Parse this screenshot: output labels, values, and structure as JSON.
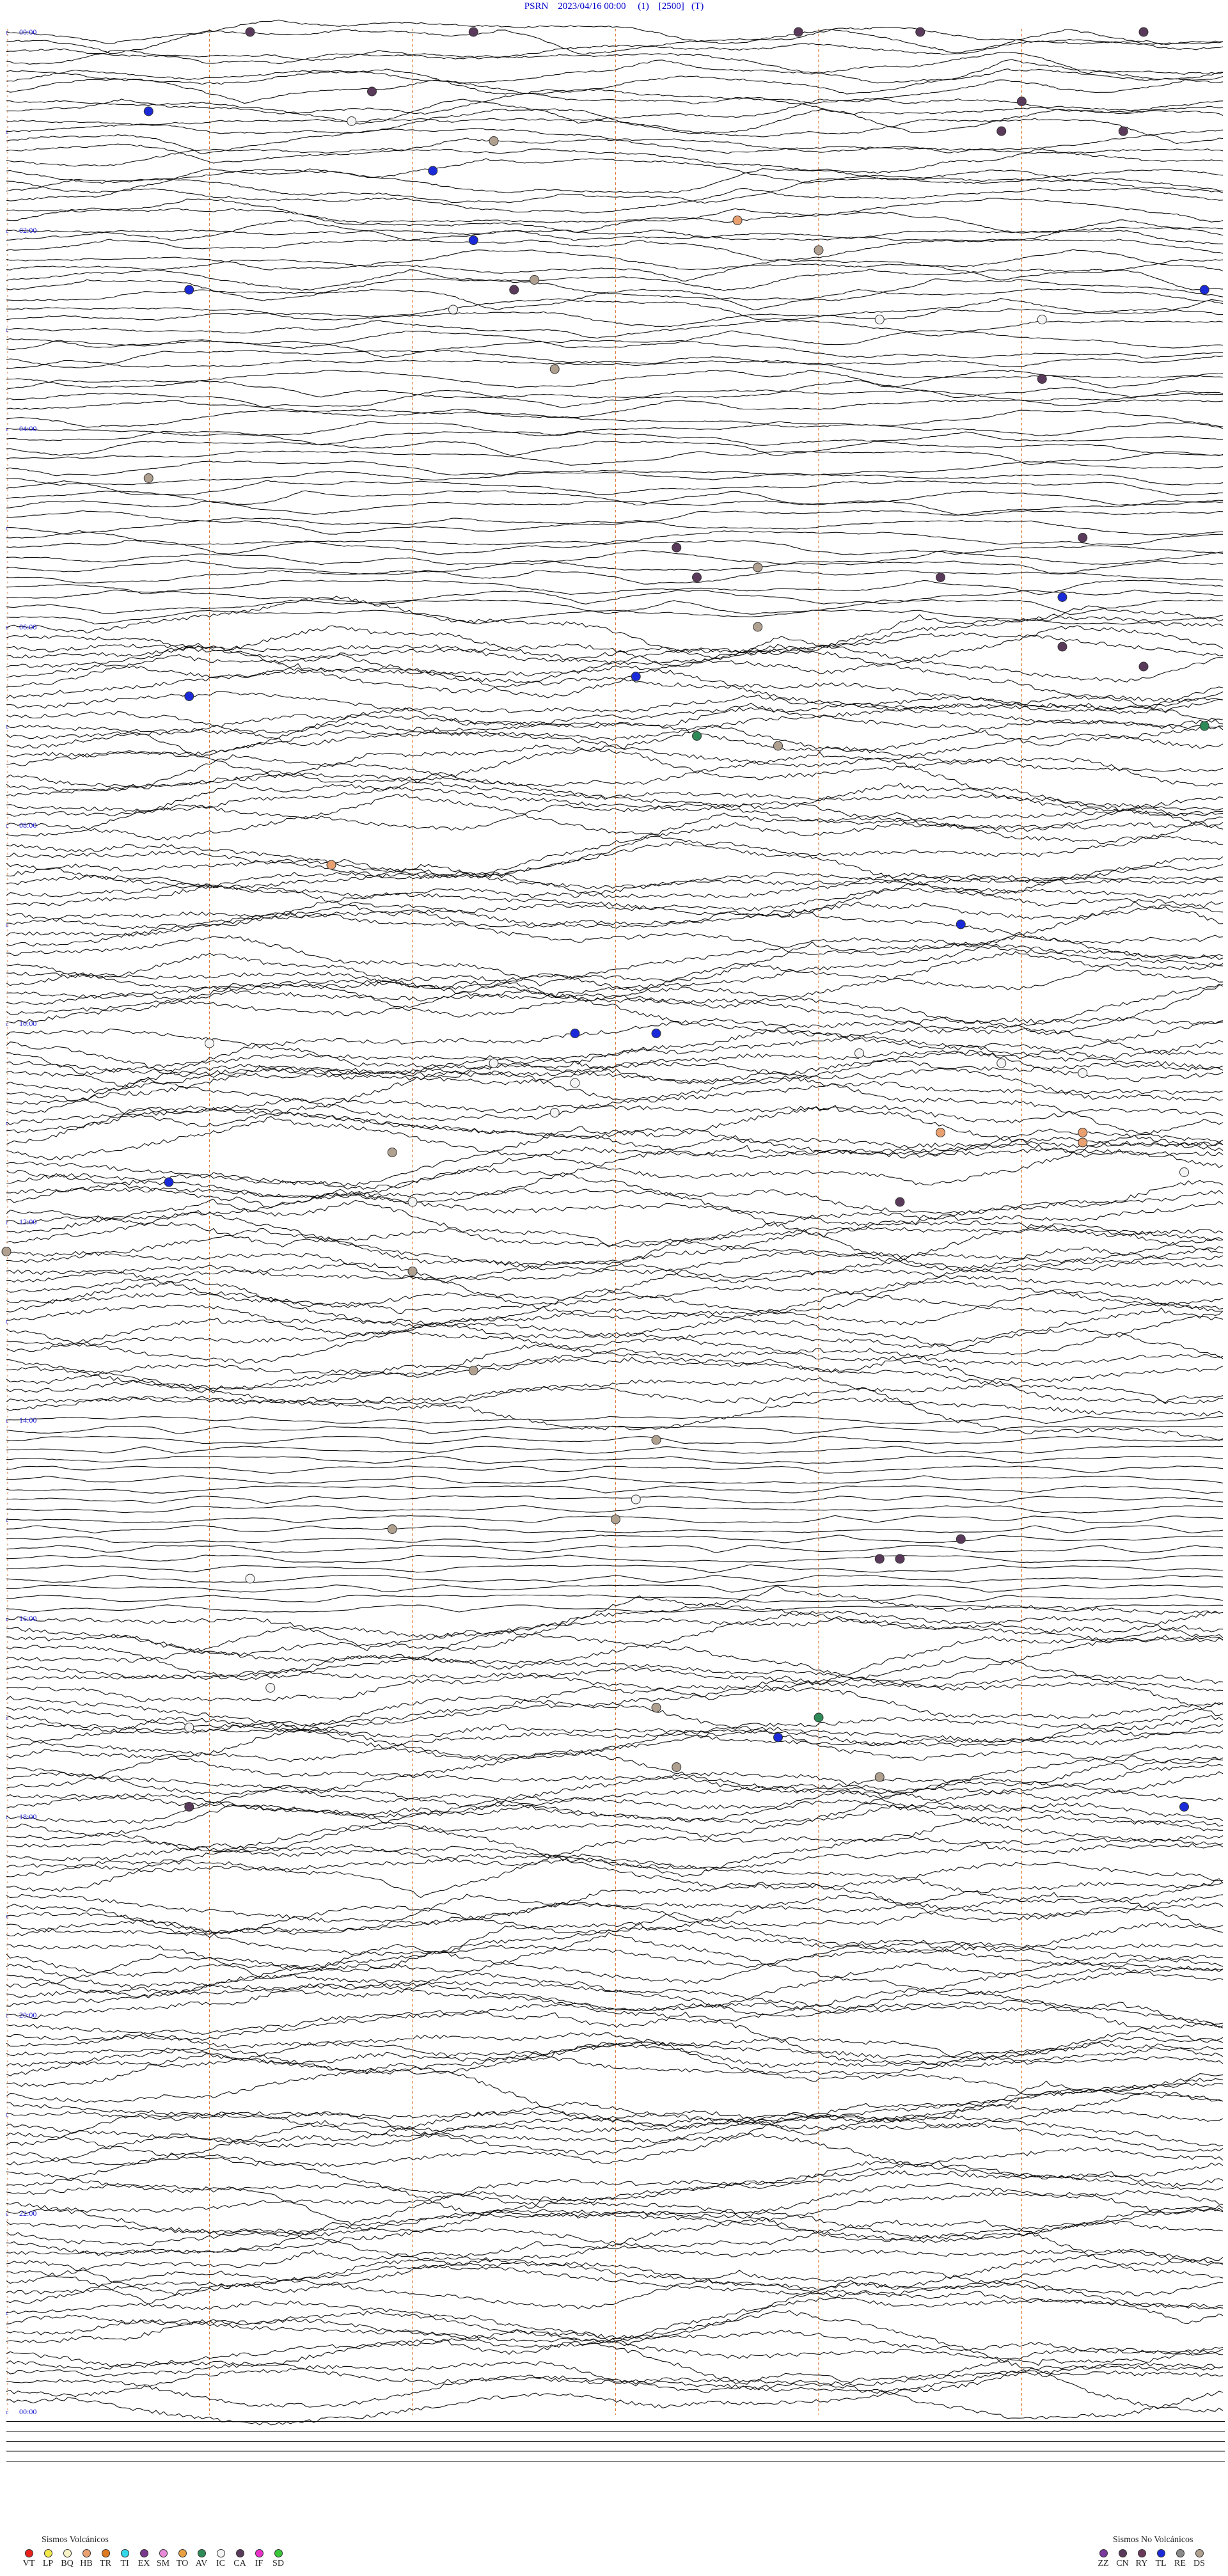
{
  "header": {
    "title": "PSRN    2023/04/16 00:00     (1)    [2500]   (T)"
  },
  "chart_data": {
    "type": "line",
    "kind": "seismogram-helicorder",
    "station": "PSRN",
    "start": "2023/04/16 00:00",
    "hour_labels": [
      "00:00",
      "02:00",
      "04:00",
      "06:00",
      "08:00",
      "10:00",
      "12:00",
      "14:00",
      "16:00",
      "18:00",
      "20:00",
      "22:00",
      "00:00"
    ],
    "lines_per_hour": 10,
    "minute_marks": [
      10,
      20,
      30,
      40,
      50
    ],
    "noise_by_hour": [
      0.35,
      0.35,
      0.3,
      0.25,
      0.2,
      0.2,
      0.9,
      0.9,
      0.9,
      0.9,
      1.0,
      1.0,
      0.9,
      0.9,
      0.1,
      0.1,
      0.9,
      0.9,
      0.9,
      0.9,
      0.9,
      0.9,
      0.9,
      0.9
    ],
    "events": [
      {
        "h": 0.0,
        "m": 23,
        "code": "CA"
      },
      {
        "h": 0.0,
        "m": 39,
        "code": "CA"
      },
      {
        "h": 0.0,
        "m": 45,
        "code": "CA"
      },
      {
        "h": 0.0,
        "m": 56,
        "code": "CA"
      },
      {
        "h": 0.0,
        "m": 12,
        "code": "CA"
      },
      {
        "h": 0.1,
        "m": 62,
        "code": "CA"
      },
      {
        "h": 0.6,
        "m": 18,
        "code": "CA"
      },
      {
        "h": 0.7,
        "m": 50,
        "code": "CA"
      },
      {
        "h": 0.8,
        "m": 7,
        "code": "TL"
      },
      {
        "h": 0.9,
        "m": 17,
        "code": "IC"
      },
      {
        "h": 1.0,
        "m": 49,
        "code": "CA"
      },
      {
        "h": 1.0,
        "m": 55,
        "code": "CA"
      },
      {
        "h": 1.1,
        "m": 24,
        "code": "DS"
      },
      {
        "h": 1.4,
        "m": 21,
        "code": "TL"
      },
      {
        "h": 1.9,
        "m": 36,
        "code": "HB"
      },
      {
        "h": 2.1,
        "m": 23,
        "code": "TL"
      },
      {
        "h": 2.2,
        "m": 40,
        "code": "DS"
      },
      {
        "h": 2.6,
        "m": 9,
        "code": "TL"
      },
      {
        "h": 2.5,
        "m": 26,
        "code": "DS"
      },
      {
        "h": 2.6,
        "m": 25,
        "code": "CA"
      },
      {
        "h": 2.6,
        "m": 59,
        "code": "TL"
      },
      {
        "h": 2.8,
        "m": 22,
        "code": "IC"
      },
      {
        "h": 2.9,
        "m": 43,
        "code": "IC"
      },
      {
        "h": 2.9,
        "m": 51,
        "code": "IC"
      },
      {
        "h": 3.4,
        "m": 27,
        "code": "DS"
      },
      {
        "h": 3.5,
        "m": 51,
        "code": "CA"
      },
      {
        "h": 4.5,
        "m": 7,
        "code": "DS"
      },
      {
        "h": 5.1,
        "m": 53,
        "code": "CA"
      },
      {
        "h": 5.2,
        "m": 33,
        "code": "CA"
      },
      {
        "h": 5.4,
        "m": 37,
        "code": "DS"
      },
      {
        "h": 5.5,
        "m": 46,
        "code": "CA"
      },
      {
        "h": 5.5,
        "m": 34,
        "code": "CA"
      },
      {
        "h": 5.7,
        "m": 52,
        "code": "TL"
      },
      {
        "h": 6.0,
        "m": 37,
        "code": "DS"
      },
      {
        "h": 6.2,
        "m": 52,
        "code": "CA"
      },
      {
        "h": 6.4,
        "m": 56,
        "code": "CA"
      },
      {
        "h": 6.5,
        "m": 31,
        "code": "TL"
      },
      {
        "h": 6.7,
        "m": 9,
        "code": "TL"
      },
      {
        "h": 7.0,
        "m": 59,
        "code": "AV"
      },
      {
        "h": 7.1,
        "m": 34,
        "code": "AV"
      },
      {
        "h": 7.2,
        "m": 38,
        "code": "DS"
      },
      {
        "h": 8.4,
        "m": 16,
        "code": "HB"
      },
      {
        "h": 9.0,
        "m": 47,
        "code": "TL"
      },
      {
        "h": 10.1,
        "m": 28,
        "code": "TL"
      },
      {
        "h": 10.1,
        "m": 32,
        "code": "TL"
      },
      {
        "h": 10.2,
        "m": 10,
        "code": "IC"
      },
      {
        "h": 10.4,
        "m": 24,
        "code": "IC"
      },
      {
        "h": 10.4,
        "m": 49,
        "code": "IC"
      },
      {
        "h": 10.3,
        "m": 42,
        "code": "IC"
      },
      {
        "h": 10.6,
        "m": 28,
        "code": "IC"
      },
      {
        "h": 10.5,
        "m": 53,
        "code": "IC"
      },
      {
        "h": 10.9,
        "m": 27,
        "code": "IC"
      },
      {
        "h": 11.1,
        "m": 46,
        "code": "HB"
      },
      {
        "h": 11.1,
        "m": 53,
        "code": "HB"
      },
      {
        "h": 11.2,
        "m": 53,
        "code": "HB"
      },
      {
        "h": 11.3,
        "m": 19,
        "code": "DS"
      },
      {
        "h": 11.5,
        "m": 58,
        "code": "IC"
      },
      {
        "h": 11.6,
        "m": 8,
        "code": "TL"
      },
      {
        "h": 11.8,
        "m": 20,
        "code": "IC"
      },
      {
        "h": 11.8,
        "m": 44,
        "code": "CA"
      },
      {
        "h": 12.3,
        "m": 0,
        "code": "DS"
      },
      {
        "h": 12.5,
        "m": 20,
        "code": "DS"
      },
      {
        "h": 13.5,
        "m": 23,
        "code": "DS"
      },
      {
        "h": 14.2,
        "m": 32,
        "code": "DS"
      },
      {
        "h": 14.8,
        "m": 31,
        "code": "IC"
      },
      {
        "h": 15.0,
        "m": 30,
        "code": "DS"
      },
      {
        "h": 15.1,
        "m": 19,
        "code": "DS"
      },
      {
        "h": 15.2,
        "m": 47,
        "code": "CA"
      },
      {
        "h": 15.4,
        "m": 44,
        "code": "CA"
      },
      {
        "h": 15.4,
        "m": 43,
        "code": "CA"
      },
      {
        "h": 15.6,
        "m": 12,
        "code": "IC"
      },
      {
        "h": 16.7,
        "m": 13,
        "code": "IC"
      },
      {
        "h": 16.9,
        "m": 32,
        "code": "DS"
      },
      {
        "h": 17.1,
        "m": 9,
        "code": "IC"
      },
      {
        "h": 17.0,
        "m": 40,
        "code": "AV"
      },
      {
        "h": 17.2,
        "m": 38,
        "code": "TL"
      },
      {
        "h": 17.5,
        "m": 33,
        "code": "DS"
      },
      {
        "h": 17.6,
        "m": 43,
        "code": "DS"
      },
      {
        "h": 17.9,
        "m": 58,
        "code": "TL"
      },
      {
        "h": 17.9,
        "m": 9,
        "code": "CA"
      }
    ]
  },
  "legend_volcanic": {
    "title": "Sismos Volcánicos",
    "items": [
      {
        "code": "VT",
        "color": "#e8211d"
      },
      {
        "code": "LP",
        "color": "#f2e84a"
      },
      {
        "code": "BQ",
        "color": "#f8f4c8"
      },
      {
        "code": "HB",
        "color": "#e8a070"
      },
      {
        "code": "TR",
        "color": "#e07b20"
      },
      {
        "code": "TI",
        "color": "#30d8e8"
      },
      {
        "code": "EX",
        "color": "#7a3a8c"
      },
      {
        "code": "SM",
        "color": "#e88ad8"
      },
      {
        "code": "TO",
        "color": "#e8a040"
      },
      {
        "code": "AV",
        "color": "#2e8b57"
      },
      {
        "code": "IC",
        "color": "#f4f4f4"
      },
      {
        "code": "CA",
        "color": "#5a3a5a"
      },
      {
        "code": "IF",
        "color": "#e832c8"
      },
      {
        "code": "SD",
        "color": "#3ac83a"
      }
    ]
  },
  "legend_nonvolcanic": {
    "title": "Sismos No Volcánicos",
    "items": [
      {
        "code": "ZZ",
        "color": "#7a3a9c"
      },
      {
        "code": "CN",
        "color": "#5a3a5a"
      },
      {
        "code": "RY",
        "color": "#6a3a5a"
      },
      {
        "code": "TL",
        "color": "#1a2ad8"
      },
      {
        "code": "RE",
        "color": "#8a8a8a"
      },
      {
        "code": "DS",
        "color": "#b0a090"
      }
    ]
  }
}
